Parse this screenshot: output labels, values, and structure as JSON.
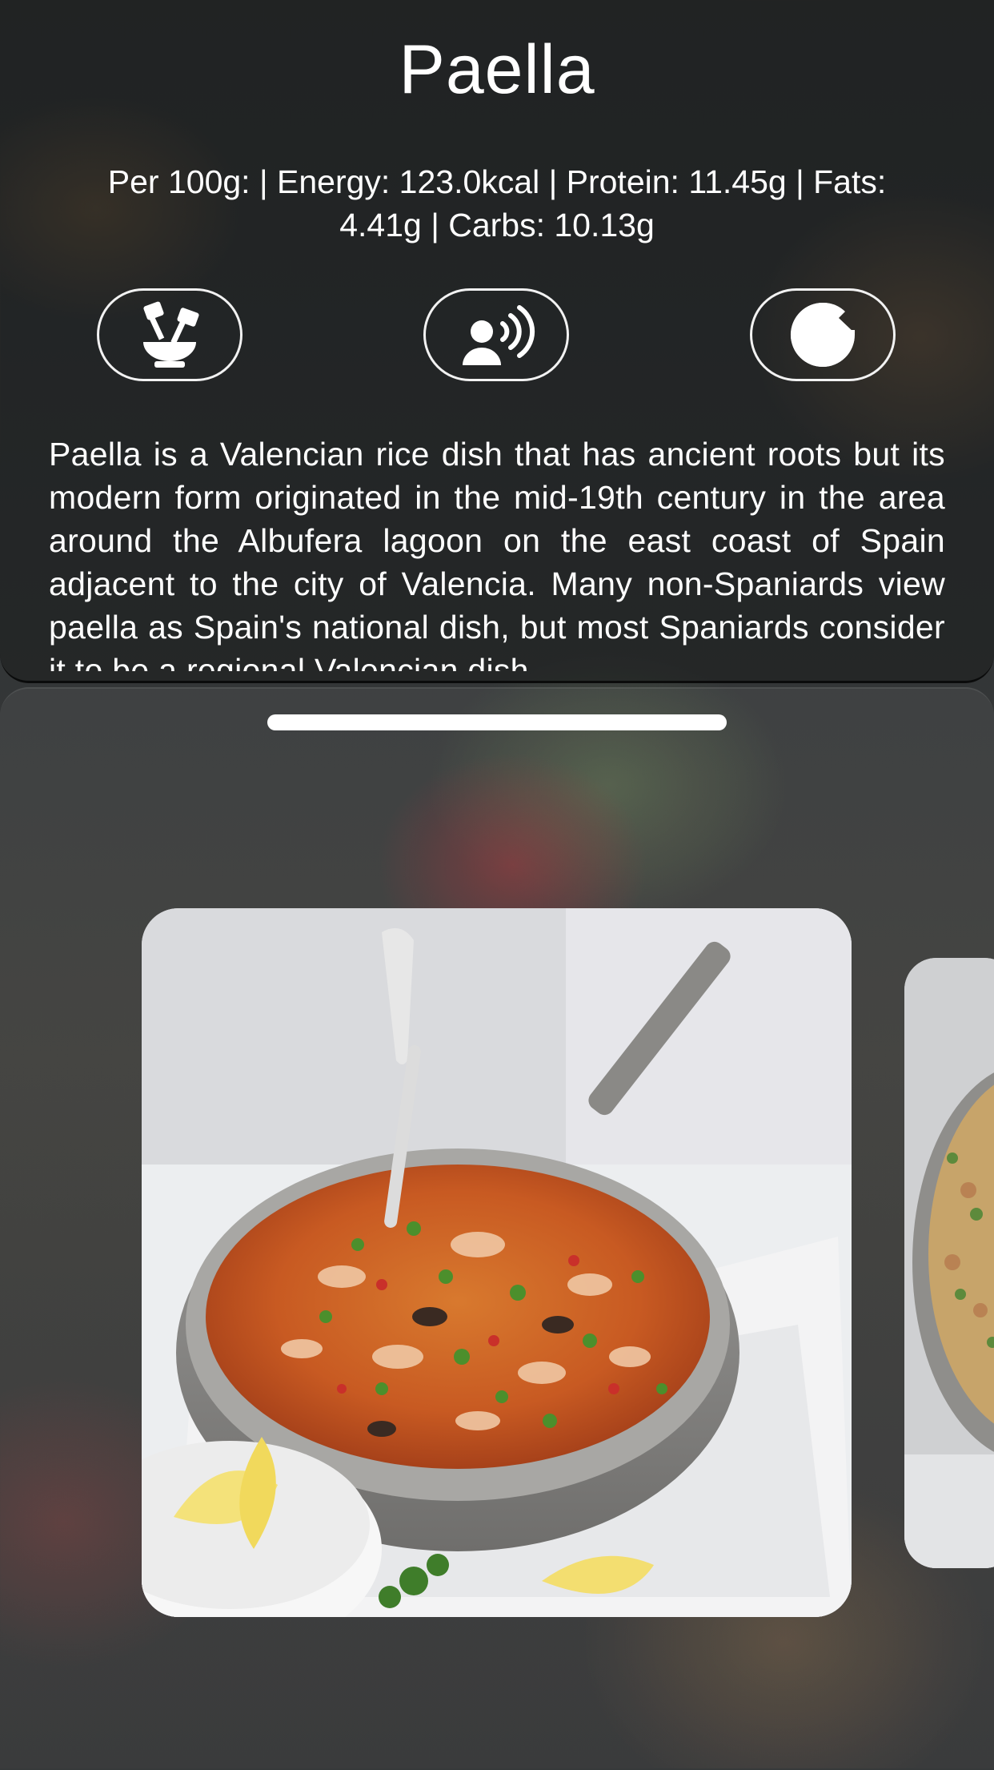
{
  "recipe": {
    "title": "Paella",
    "nutrition": "Per 100g: | Energy: 123.0kcal | Protein: 11.45g | Fats: 4.41g | Carbs: 10.13g",
    "description": "Paella is a Valencian rice dish that has ancient roots but its modern form originated in the mid-19th century in the area around the Albufera lagoon on the east coast of Spain adjacent to the city of Valencia. Many non-Spaniards view paella as Spain's national dish, but most Spaniards consider it to be a regional Valencian dish."
  },
  "actions": [
    {
      "icon": "mortar-pestle-icon"
    },
    {
      "icon": "speaker-voice-icon"
    },
    {
      "icon": "google-icon"
    }
  ],
  "colors": {
    "text": "#ffffff",
    "panel_border": "#f2f2f2"
  }
}
